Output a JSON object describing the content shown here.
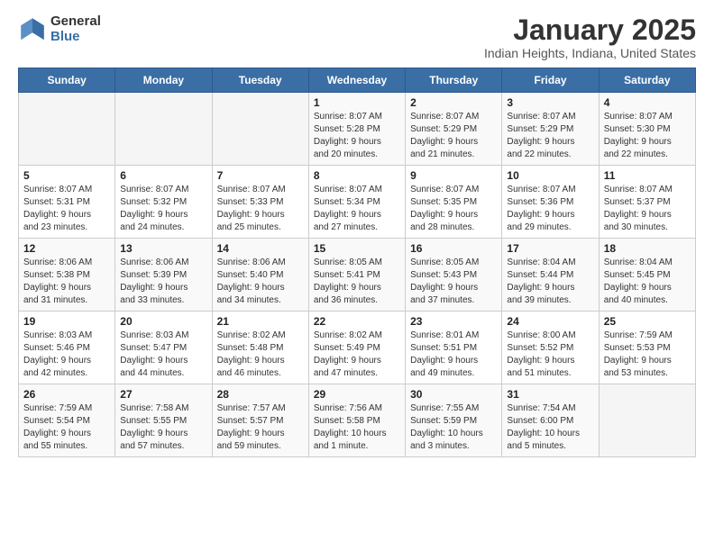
{
  "header": {
    "logo_general": "General",
    "logo_blue": "Blue",
    "title": "January 2025",
    "subtitle": "Indian Heights, Indiana, United States"
  },
  "weekdays": [
    "Sunday",
    "Monday",
    "Tuesday",
    "Wednesday",
    "Thursday",
    "Friday",
    "Saturday"
  ],
  "weeks": [
    [
      {
        "day": "",
        "info": ""
      },
      {
        "day": "",
        "info": ""
      },
      {
        "day": "",
        "info": ""
      },
      {
        "day": "1",
        "info": "Sunrise: 8:07 AM\nSunset: 5:28 PM\nDaylight: 9 hours\nand 20 minutes."
      },
      {
        "day": "2",
        "info": "Sunrise: 8:07 AM\nSunset: 5:29 PM\nDaylight: 9 hours\nand 21 minutes."
      },
      {
        "day": "3",
        "info": "Sunrise: 8:07 AM\nSunset: 5:29 PM\nDaylight: 9 hours\nand 22 minutes."
      },
      {
        "day": "4",
        "info": "Sunrise: 8:07 AM\nSunset: 5:30 PM\nDaylight: 9 hours\nand 22 minutes."
      }
    ],
    [
      {
        "day": "5",
        "info": "Sunrise: 8:07 AM\nSunset: 5:31 PM\nDaylight: 9 hours\nand 23 minutes."
      },
      {
        "day": "6",
        "info": "Sunrise: 8:07 AM\nSunset: 5:32 PM\nDaylight: 9 hours\nand 24 minutes."
      },
      {
        "day": "7",
        "info": "Sunrise: 8:07 AM\nSunset: 5:33 PM\nDaylight: 9 hours\nand 25 minutes."
      },
      {
        "day": "8",
        "info": "Sunrise: 8:07 AM\nSunset: 5:34 PM\nDaylight: 9 hours\nand 27 minutes."
      },
      {
        "day": "9",
        "info": "Sunrise: 8:07 AM\nSunset: 5:35 PM\nDaylight: 9 hours\nand 28 minutes."
      },
      {
        "day": "10",
        "info": "Sunrise: 8:07 AM\nSunset: 5:36 PM\nDaylight: 9 hours\nand 29 minutes."
      },
      {
        "day": "11",
        "info": "Sunrise: 8:07 AM\nSunset: 5:37 PM\nDaylight: 9 hours\nand 30 minutes."
      }
    ],
    [
      {
        "day": "12",
        "info": "Sunrise: 8:06 AM\nSunset: 5:38 PM\nDaylight: 9 hours\nand 31 minutes."
      },
      {
        "day": "13",
        "info": "Sunrise: 8:06 AM\nSunset: 5:39 PM\nDaylight: 9 hours\nand 33 minutes."
      },
      {
        "day": "14",
        "info": "Sunrise: 8:06 AM\nSunset: 5:40 PM\nDaylight: 9 hours\nand 34 minutes."
      },
      {
        "day": "15",
        "info": "Sunrise: 8:05 AM\nSunset: 5:41 PM\nDaylight: 9 hours\nand 36 minutes."
      },
      {
        "day": "16",
        "info": "Sunrise: 8:05 AM\nSunset: 5:43 PM\nDaylight: 9 hours\nand 37 minutes."
      },
      {
        "day": "17",
        "info": "Sunrise: 8:04 AM\nSunset: 5:44 PM\nDaylight: 9 hours\nand 39 minutes."
      },
      {
        "day": "18",
        "info": "Sunrise: 8:04 AM\nSunset: 5:45 PM\nDaylight: 9 hours\nand 40 minutes."
      }
    ],
    [
      {
        "day": "19",
        "info": "Sunrise: 8:03 AM\nSunset: 5:46 PM\nDaylight: 9 hours\nand 42 minutes."
      },
      {
        "day": "20",
        "info": "Sunrise: 8:03 AM\nSunset: 5:47 PM\nDaylight: 9 hours\nand 44 minutes."
      },
      {
        "day": "21",
        "info": "Sunrise: 8:02 AM\nSunset: 5:48 PM\nDaylight: 9 hours\nand 46 minutes."
      },
      {
        "day": "22",
        "info": "Sunrise: 8:02 AM\nSunset: 5:49 PM\nDaylight: 9 hours\nand 47 minutes."
      },
      {
        "day": "23",
        "info": "Sunrise: 8:01 AM\nSunset: 5:51 PM\nDaylight: 9 hours\nand 49 minutes."
      },
      {
        "day": "24",
        "info": "Sunrise: 8:00 AM\nSunset: 5:52 PM\nDaylight: 9 hours\nand 51 minutes."
      },
      {
        "day": "25",
        "info": "Sunrise: 7:59 AM\nSunset: 5:53 PM\nDaylight: 9 hours\nand 53 minutes."
      }
    ],
    [
      {
        "day": "26",
        "info": "Sunrise: 7:59 AM\nSunset: 5:54 PM\nDaylight: 9 hours\nand 55 minutes."
      },
      {
        "day": "27",
        "info": "Sunrise: 7:58 AM\nSunset: 5:55 PM\nDaylight: 9 hours\nand 57 minutes."
      },
      {
        "day": "28",
        "info": "Sunrise: 7:57 AM\nSunset: 5:57 PM\nDaylight: 9 hours\nand 59 minutes."
      },
      {
        "day": "29",
        "info": "Sunrise: 7:56 AM\nSunset: 5:58 PM\nDaylight: 10 hours\nand 1 minute."
      },
      {
        "day": "30",
        "info": "Sunrise: 7:55 AM\nSunset: 5:59 PM\nDaylight: 10 hours\nand 3 minutes."
      },
      {
        "day": "31",
        "info": "Sunrise: 7:54 AM\nSunset: 6:00 PM\nDaylight: 10 hours\nand 5 minutes."
      },
      {
        "day": "",
        "info": ""
      }
    ]
  ]
}
